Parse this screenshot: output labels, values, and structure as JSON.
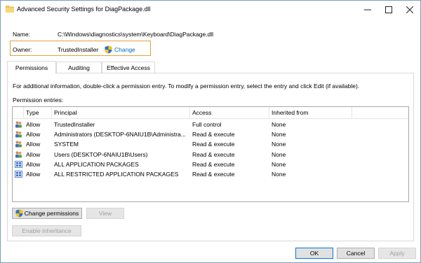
{
  "window": {
    "title": "Advanced Security Settings for DiagPackage.dll",
    "minimize_glyph": "—",
    "maximize_glyph": "☐",
    "close_glyph": "✕"
  },
  "fields": {
    "name_label": "Name:",
    "name_value": "C:\\Windows\\diagnostics\\system\\Keyboard\\DiagPackage.dll",
    "owner_label": "Owner:",
    "owner_value": "TrustedInstaller",
    "change_link": "Change"
  },
  "tabs": [
    {
      "label": "Permissions",
      "active": true
    },
    {
      "label": "Auditing",
      "active": false
    },
    {
      "label": "Effective Access",
      "active": false
    }
  ],
  "info_text": "For additional information, double-click a permission entry. To modify a permission entry, select the entry and click Edit (if available).",
  "entries_label": "Permission entries:",
  "columns": {
    "type": "Type",
    "principal": "Principal",
    "access": "Access",
    "inherited": "Inherited from"
  },
  "entries": [
    {
      "icon": "users-icon",
      "type": "Allow",
      "principal": "TrustedInstaller",
      "access": "Full control",
      "inherited": "None"
    },
    {
      "icon": "users-icon",
      "type": "Allow",
      "principal": "Administrators (DESKTOP-6NAIU1B\\Administra...",
      "access": "Read & execute",
      "inherited": "None"
    },
    {
      "icon": "users-icon",
      "type": "Allow",
      "principal": "SYSTEM",
      "access": "Read & execute",
      "inherited": "None"
    },
    {
      "icon": "users-icon",
      "type": "Allow",
      "principal": "Users (DESKTOP-6NAIU1B\\Users)",
      "access": "Read & execute",
      "inherited": "None"
    },
    {
      "icon": "app-package-icon",
      "type": "Allow",
      "principal": "ALL APPLICATION PACKAGES",
      "access": "Read & execute",
      "inherited": "None"
    },
    {
      "icon": "app-package-icon",
      "type": "Allow",
      "principal": "ALL RESTRICTED APPLICATION PACKAGES",
      "access": "Read & execute",
      "inherited": "None"
    }
  ],
  "buttons": {
    "change_permissions": "Change permissions",
    "view": "View",
    "enable_inheritance": "Enable inheritance",
    "ok": "OK",
    "cancel": "Cancel",
    "apply": "Apply"
  },
  "colors": {
    "link": "#0066cc",
    "owner_highlight": "#e3a13c",
    "primary_border": "#0078d7"
  }
}
